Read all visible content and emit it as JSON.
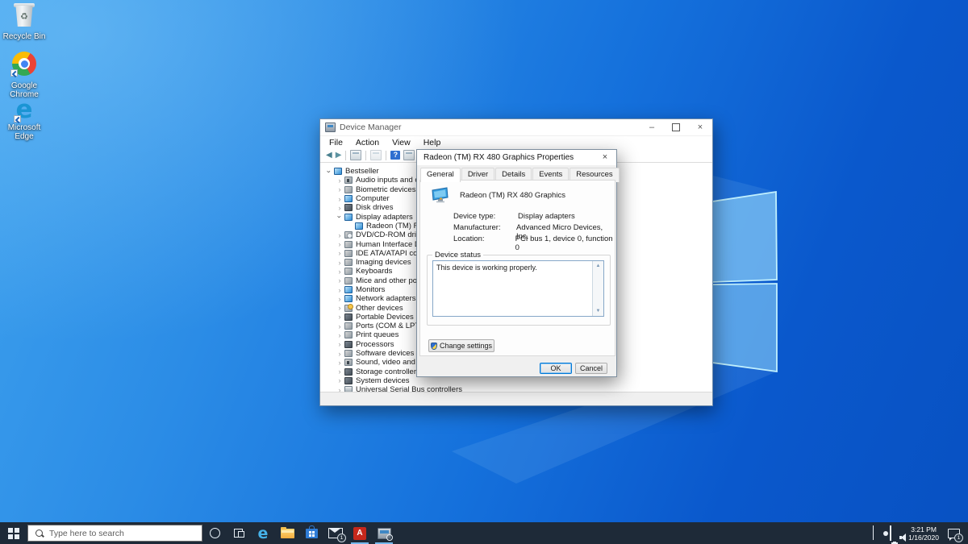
{
  "desktop": {
    "icons": [
      {
        "name": "recycle-bin",
        "label": "Recycle Bin"
      },
      {
        "name": "google-chrome",
        "label": "Google Chrome"
      },
      {
        "name": "microsoft-edge",
        "label": "Microsoft Edge"
      }
    ],
    "wallpaper_colors": {
      "light": "#3fa2ee",
      "dark": "#0851c2",
      "logo_edge": "#bfefff",
      "logo_fill": "#55b0ee"
    }
  },
  "device_manager": {
    "title": "Device Manager",
    "menu": [
      "File",
      "Action",
      "View",
      "Help"
    ],
    "toolbar_icons": [
      "back-arrow",
      "forward-arrow",
      "separator",
      "console-window",
      "separator",
      "properties-window",
      "separator",
      "help",
      "scan-window",
      "separator",
      "more-window"
    ],
    "window_buttons": [
      "minimize",
      "maximize",
      "close"
    ],
    "tree": [
      {
        "level": 0,
        "chev": "expanded",
        "icon": "computer",
        "label": "Bestseller"
      },
      {
        "level": 1,
        "chev": "collapsed",
        "icon": "audio",
        "label": "Audio inputs and outputs"
      },
      {
        "level": 1,
        "chev": "collapsed",
        "icon": "biometric",
        "label": "Biometric devices"
      },
      {
        "level": 1,
        "chev": "collapsed",
        "icon": "computer2",
        "label": "Computer"
      },
      {
        "level": 1,
        "chev": "collapsed",
        "icon": "disk",
        "label": "Disk drives"
      },
      {
        "level": 1,
        "chev": "expanded",
        "icon": "display",
        "label": "Display adapters"
      },
      {
        "level": 2,
        "chev": "none",
        "icon": "display",
        "label": "Radeon (TM) RX 480 Graphics"
      },
      {
        "level": 1,
        "chev": "collapsed",
        "icon": "dvd",
        "label": "DVD/CD-ROM drives"
      },
      {
        "level": 1,
        "chev": "collapsed",
        "icon": "hid",
        "label": "Human Interface Devices"
      },
      {
        "level": 1,
        "chev": "collapsed",
        "icon": "ide",
        "label": "IDE ATA/ATAPI controllers"
      },
      {
        "level": 1,
        "chev": "collapsed",
        "icon": "imaging",
        "label": "Imaging devices"
      },
      {
        "level": 1,
        "chev": "collapsed",
        "icon": "keyboard",
        "label": "Keyboards"
      },
      {
        "level": 1,
        "chev": "collapsed",
        "icon": "mouse",
        "label": "Mice and other pointing devices"
      },
      {
        "level": 1,
        "chev": "collapsed",
        "icon": "monitor",
        "label": "Monitors"
      },
      {
        "level": 1,
        "chev": "collapsed",
        "icon": "network",
        "label": "Network adapters"
      },
      {
        "level": 1,
        "chev": "collapsed",
        "icon": "other",
        "label": "Other devices"
      },
      {
        "level": 1,
        "chev": "collapsed",
        "icon": "portable",
        "label": "Portable Devices"
      },
      {
        "level": 1,
        "chev": "collapsed",
        "icon": "ports",
        "label": "Ports (COM & LPT)"
      },
      {
        "level": 1,
        "chev": "collapsed",
        "icon": "print",
        "label": "Print queues"
      },
      {
        "level": 1,
        "chev": "collapsed",
        "icon": "processor",
        "label": "Processors"
      },
      {
        "level": 1,
        "chev": "collapsed",
        "icon": "software",
        "label": "Software devices"
      },
      {
        "level": 1,
        "chev": "collapsed",
        "icon": "sound",
        "label": "Sound, video and game controllers"
      },
      {
        "level": 1,
        "chev": "collapsed",
        "icon": "storage",
        "label": "Storage controllers"
      },
      {
        "level": 1,
        "chev": "collapsed",
        "icon": "system",
        "label": "System devices"
      },
      {
        "level": 1,
        "chev": "collapsed",
        "icon": "usb",
        "label": "Universal Serial Bus controllers"
      }
    ]
  },
  "dialog": {
    "title": "Radeon (TM) RX 480 Graphics Properties",
    "close_glyph": "×",
    "tabs": [
      "General",
      "Driver",
      "Details",
      "Events",
      "Resources"
    ],
    "active_tab": "General",
    "device_name": "Radeon (TM) RX 480 Graphics",
    "fields": [
      {
        "label": "Device type:",
        "value": "Display adapters"
      },
      {
        "label": "Manufacturer:",
        "value": "Advanced Micro Devices, Inc."
      },
      {
        "label": "Location:",
        "value": "PCI bus 1, device 0, function 0"
      }
    ],
    "status_group_label": "Device status",
    "status_text": "This device is working properly.",
    "change_settings_label": "Change settings",
    "ok_label": "OK",
    "cancel_label": "Cancel",
    "accent_color": "#0078d7"
  },
  "taskbar": {
    "search_placeholder": "Type here to search",
    "apps": [
      {
        "icon": "edge",
        "active": false
      },
      {
        "icon": "file-explorer",
        "active": false
      },
      {
        "icon": "store",
        "active": false
      },
      {
        "icon": "mail",
        "active": false,
        "badge": "1"
      },
      {
        "icon": "acrobat",
        "active": true
      },
      {
        "icon": "device-manager",
        "active": true
      }
    ],
    "tray_icons": [
      "hidden-icons-chevron",
      "onedrive-cloud",
      "network",
      "volume"
    ],
    "clock_time": "3:21 PM",
    "clock_date": "1/16/2020",
    "action_center_badge": "1"
  }
}
